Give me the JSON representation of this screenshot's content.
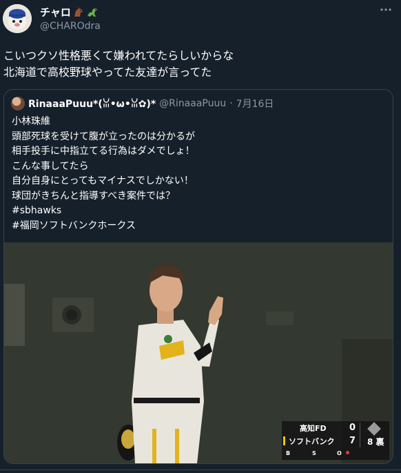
{
  "author": {
    "display_name": "チャロ",
    "handle": "@CHAROdra"
  },
  "tweet": {
    "text": "こいつクソ性格悪くて嫌われてたらしいからな\n北海道で高校野球やってた友達が言ってた"
  },
  "quote": {
    "display_name": "RinaaaPuuu*(ꈍ•ω•ꈍ✿)*",
    "handle": "@RinaaaPuuu",
    "separator": "·",
    "date": "7月16日",
    "lines": [
      "小林珠維",
      "頭部死球を受けて腹が立ったのは分かるが",
      "相手投手に中指立てる行為はダメでしょ！",
      "こんな事してたら",
      "自分自身にとってもマイナスでしかない！",
      "球団がきちんと指導すべき案件では？"
    ],
    "hashtags": [
      "#sbhawks",
      "#福岡ソフトバンクホークス"
    ]
  },
  "scoreboard": {
    "team1": "高知FD",
    "score1": "0",
    "team2": "ソフトバンク",
    "score2": "7",
    "inning": "8 裏",
    "b_label": "B",
    "s_label": "S",
    "o_label": "O"
  },
  "icons": {
    "more": "more-dots-icon",
    "header_emoji": [
      "horse-icon",
      "dinosaur-icon"
    ]
  },
  "colors": {
    "background": "#15202b",
    "border": "#38444d",
    "secondary_text": "#8b98a5",
    "scoreboard_accent": "#f5c400"
  }
}
